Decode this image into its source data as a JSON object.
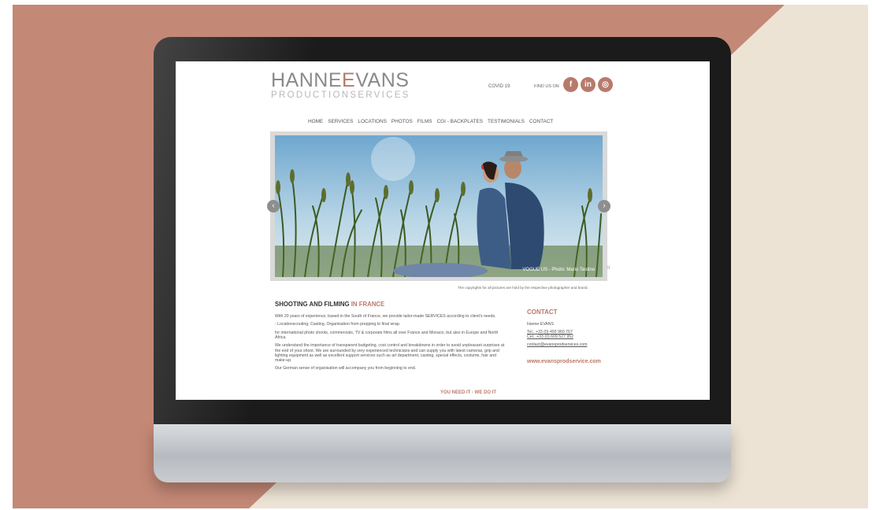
{
  "site": {
    "logo": {
      "part1": "HANNE",
      "mark": "E",
      "part2": "VANS",
      "sub": "PRODUCTIONSERVICES"
    },
    "header": {
      "covid": "COVID 19",
      "find_us": "FIND US ON",
      "social": [
        {
          "name": "facebook-icon",
          "glyph": "f"
        },
        {
          "name": "linkedin-icon",
          "glyph": "in"
        },
        {
          "name": "instagram-icon",
          "glyph": "◎"
        }
      ]
    },
    "nav": [
      "HOME",
      "SERVICES",
      "LOCATIONS",
      "PHOTOS",
      "FILMS",
      "CGI - BACKPLATES",
      "TESTIMONIALS",
      "CONTACT"
    ],
    "slider": {
      "caption": "VOGUE US - Photo: Mario Testino",
      "prev": "‹",
      "next": "›",
      "pause": "II"
    },
    "copyright": "The copyrights for all pictures are hold by the respective photographer and brand.",
    "intro": {
      "heading": "SHOOTING AND FILMING",
      "heading_highlight": "IN FRANCE",
      "paragraphs": [
        "With 20 years of experience, based in the South of France, we provide tailor-made SERVICES according to client's needs.",
        "- Locationscouting, Casting, Organisation from prepping to final wrap.",
        "for international photo shoots, commercials, TV & corporate films all over France and Monaco, but also in Europe and North Africa.",
        "We understand the importance of transparent budgeting, cost control and breakdowns in order to avoid unpleasant surprises at the end of your shoot. We are surrounded by very experienced technicians and can supply you with latest cameras, grip and lighting equipment as well as excellent support services such as art department, casting, special effects, costume, hair and make-up.",
        "Our German sense of organisation will accompany you from beginning to end."
      ],
      "tagline": "YOU NEED IT - WE DO IT"
    },
    "contact": {
      "title": "CONTACT",
      "name": "Hanne EVANS",
      "tel": "Tel.: +33 (0) 493 960 767",
      "cel": "Cel.: +33 (0) 609 527 952",
      "email": "contact@evansprodservices.com",
      "website": "www.evansprodservice.com"
    }
  },
  "colors": {
    "accent": "#b87a6a",
    "backdrop_rose": "#c48876",
    "backdrop_cream": "#ede3d5",
    "bezel": "#1b1b1b"
  }
}
